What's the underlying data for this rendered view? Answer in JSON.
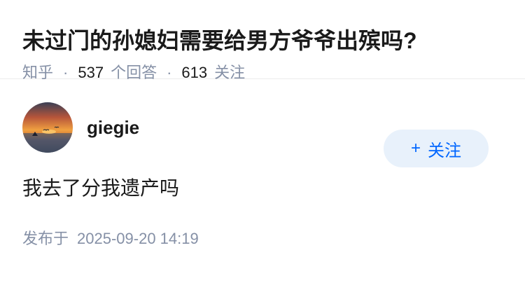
{
  "question": {
    "title": "未过门的孙媳妇需要给男方爷爷出殡吗?",
    "source": "知乎",
    "answer_count": "537",
    "answer_label": "个回答",
    "follower_count": "613",
    "follower_label": "关注",
    "separator": "·"
  },
  "answer": {
    "author_name": "giegie",
    "follow_button": "关注",
    "follow_plus": "+",
    "text": "我去了分我遗产吗",
    "publish_label": "发布于",
    "publish_time": "2025-09-20 14:19"
  },
  "colors": {
    "meta_gray": "#8590a6",
    "accent_blue": "#0066ff",
    "button_bg": "#e8f1fb"
  }
}
